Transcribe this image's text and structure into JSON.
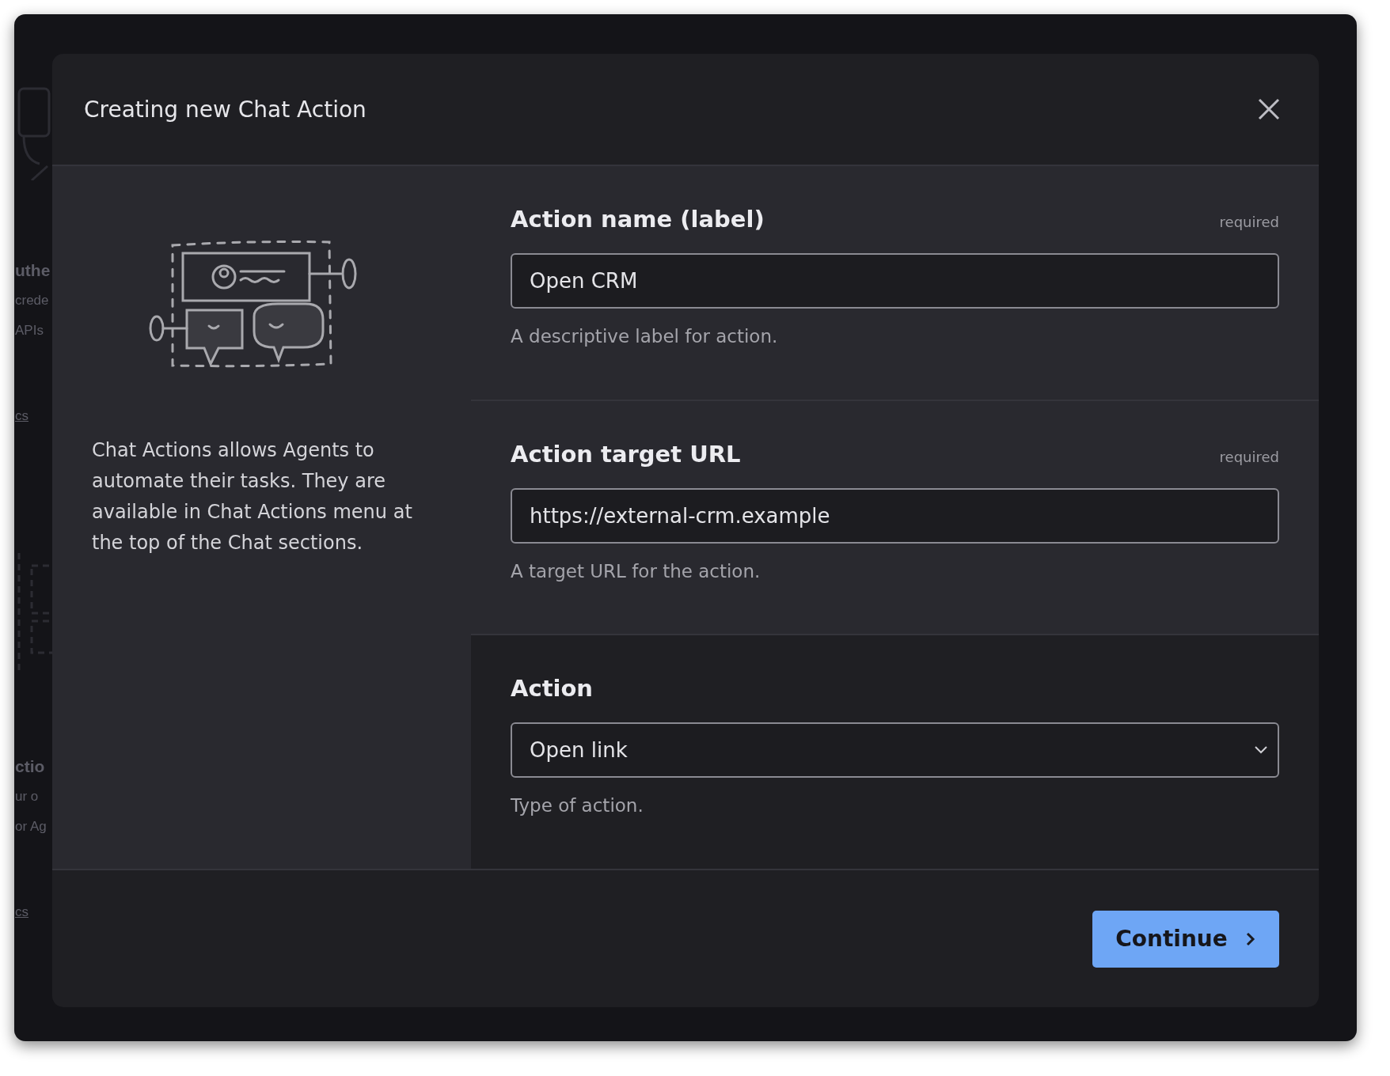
{
  "backdrop": [
    {
      "kind": "heading",
      "text": "uthe"
    },
    {
      "kind": "text",
      "text": "crede"
    },
    {
      "kind": "text",
      "text": "APIs"
    },
    {
      "kind": "link",
      "text": "cs"
    },
    {
      "kind": "heading",
      "text": "ctio"
    },
    {
      "kind": "text",
      "text": "ur o"
    },
    {
      "kind": "text",
      "text": "or Ag"
    },
    {
      "kind": "link",
      "text": "cs"
    }
  ],
  "dialog": {
    "title": "Creating new Chat Action",
    "description": "Chat Actions allows Agents to automate their tasks. They are available in Chat Actions menu at the top of the Chat sections.",
    "fields": [
      {
        "kind": "input",
        "label": "Action name (label)",
        "required": "required",
        "value": "Open CRM",
        "hint": "A descriptive label for action."
      },
      {
        "kind": "input",
        "label": "Action target URL",
        "required": "required",
        "value": "https://external-crm.example",
        "hint": "A target URL for the action."
      },
      {
        "kind": "select",
        "label": "Action",
        "value": "Open link",
        "hint": "Type of action."
      }
    ],
    "primary_button": "Continue"
  }
}
